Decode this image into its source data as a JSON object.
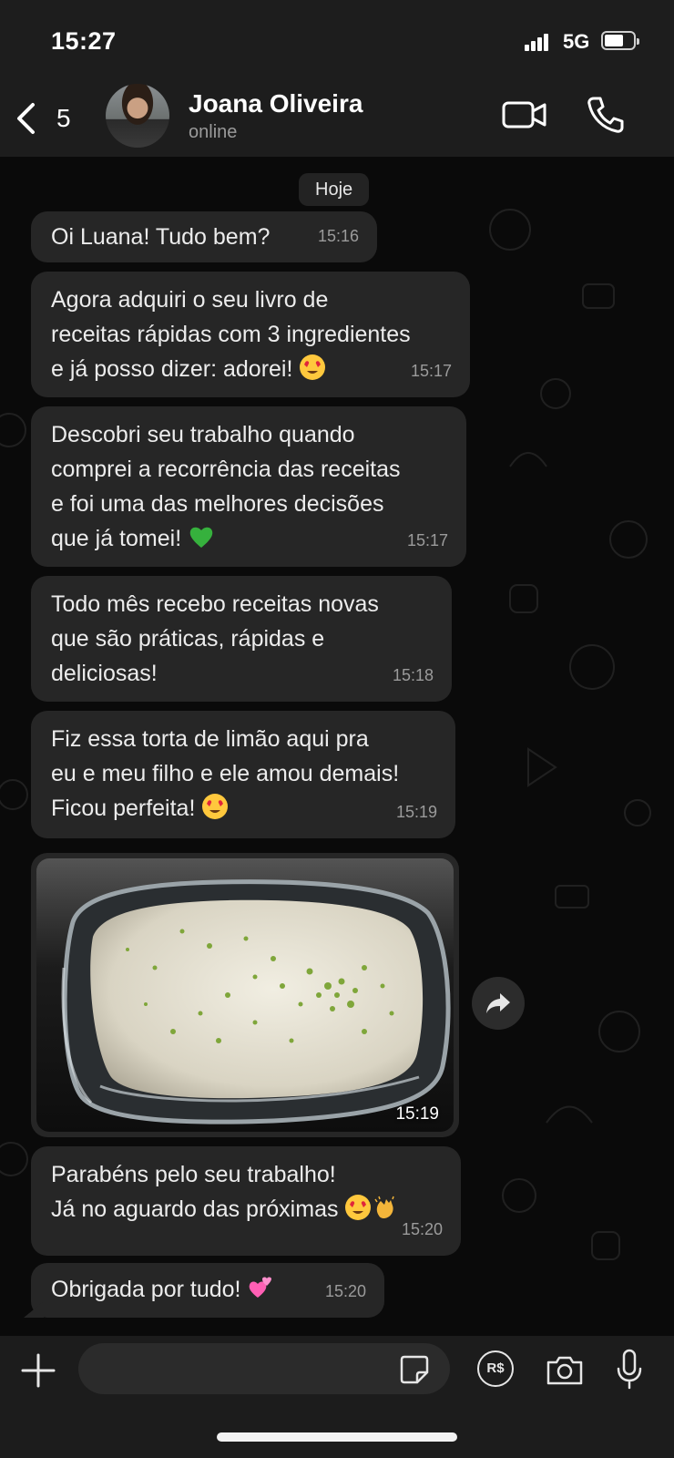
{
  "status_bar": {
    "time": "15:27",
    "network": "5G",
    "battery_level": 0.6
  },
  "header": {
    "back_count": "5",
    "contact_name": "Joana Oliveira",
    "contact_status": "online",
    "icons": [
      "chevron-left-icon",
      "video-call-icon",
      "phone-icon"
    ]
  },
  "chat": {
    "date_chip": "Hoje",
    "messages": [
      {
        "text": "Oi Luana! Tudo bem?",
        "time": "15:16"
      },
      {
        "text": "Agora adquiri o seu livro de\nreceitas rápidas com 3 ingredientes\ne já posso dizer: adorei!",
        "time": "15:17",
        "emoji": "heart-eyes-emoji"
      },
      {
        "text": "Descobri seu trabalho quando\ncomprei a recorrência das receitas\ne foi uma das melhores decisões\nque já tomei!",
        "time": "15:17",
        "emoji": "green-heart-emoji"
      },
      {
        "text": "Todo mês recebo receitas novas\nque são práticas, rápidas e\ndeliciosas!",
        "time": "15:18"
      },
      {
        "text": "Fiz essa torta de limão aqui pra\neu e meu filho e ele amou demais!\nFicou perfeita!",
        "time": "15:19",
        "emoji": "heart-eyes-emoji"
      },
      {
        "type": "photo",
        "time": "15:19",
        "icon": "forward-icon"
      },
      {
        "text": "Parabéns pelo seu trabalho!\nJá no aguardo das próximas",
        "time": "15:20",
        "emoji": "heart-eyes-emoji clapping-hands-emoji"
      },
      {
        "text": "Obrigada por tudo!",
        "time": "15:20",
        "emoji": "two-hearts-emoji"
      }
    ]
  },
  "input_bar": {
    "placeholder": "",
    "pay_label": "R$",
    "icons": [
      "plus-icon",
      "sticker-icon",
      "camera-icon",
      "microphone-icon"
    ]
  },
  "colors": {
    "background": "#0a0a0a",
    "bubble": "#262626",
    "bar": "#1c1c1c",
    "timestamp": "#9b9b9b"
  }
}
